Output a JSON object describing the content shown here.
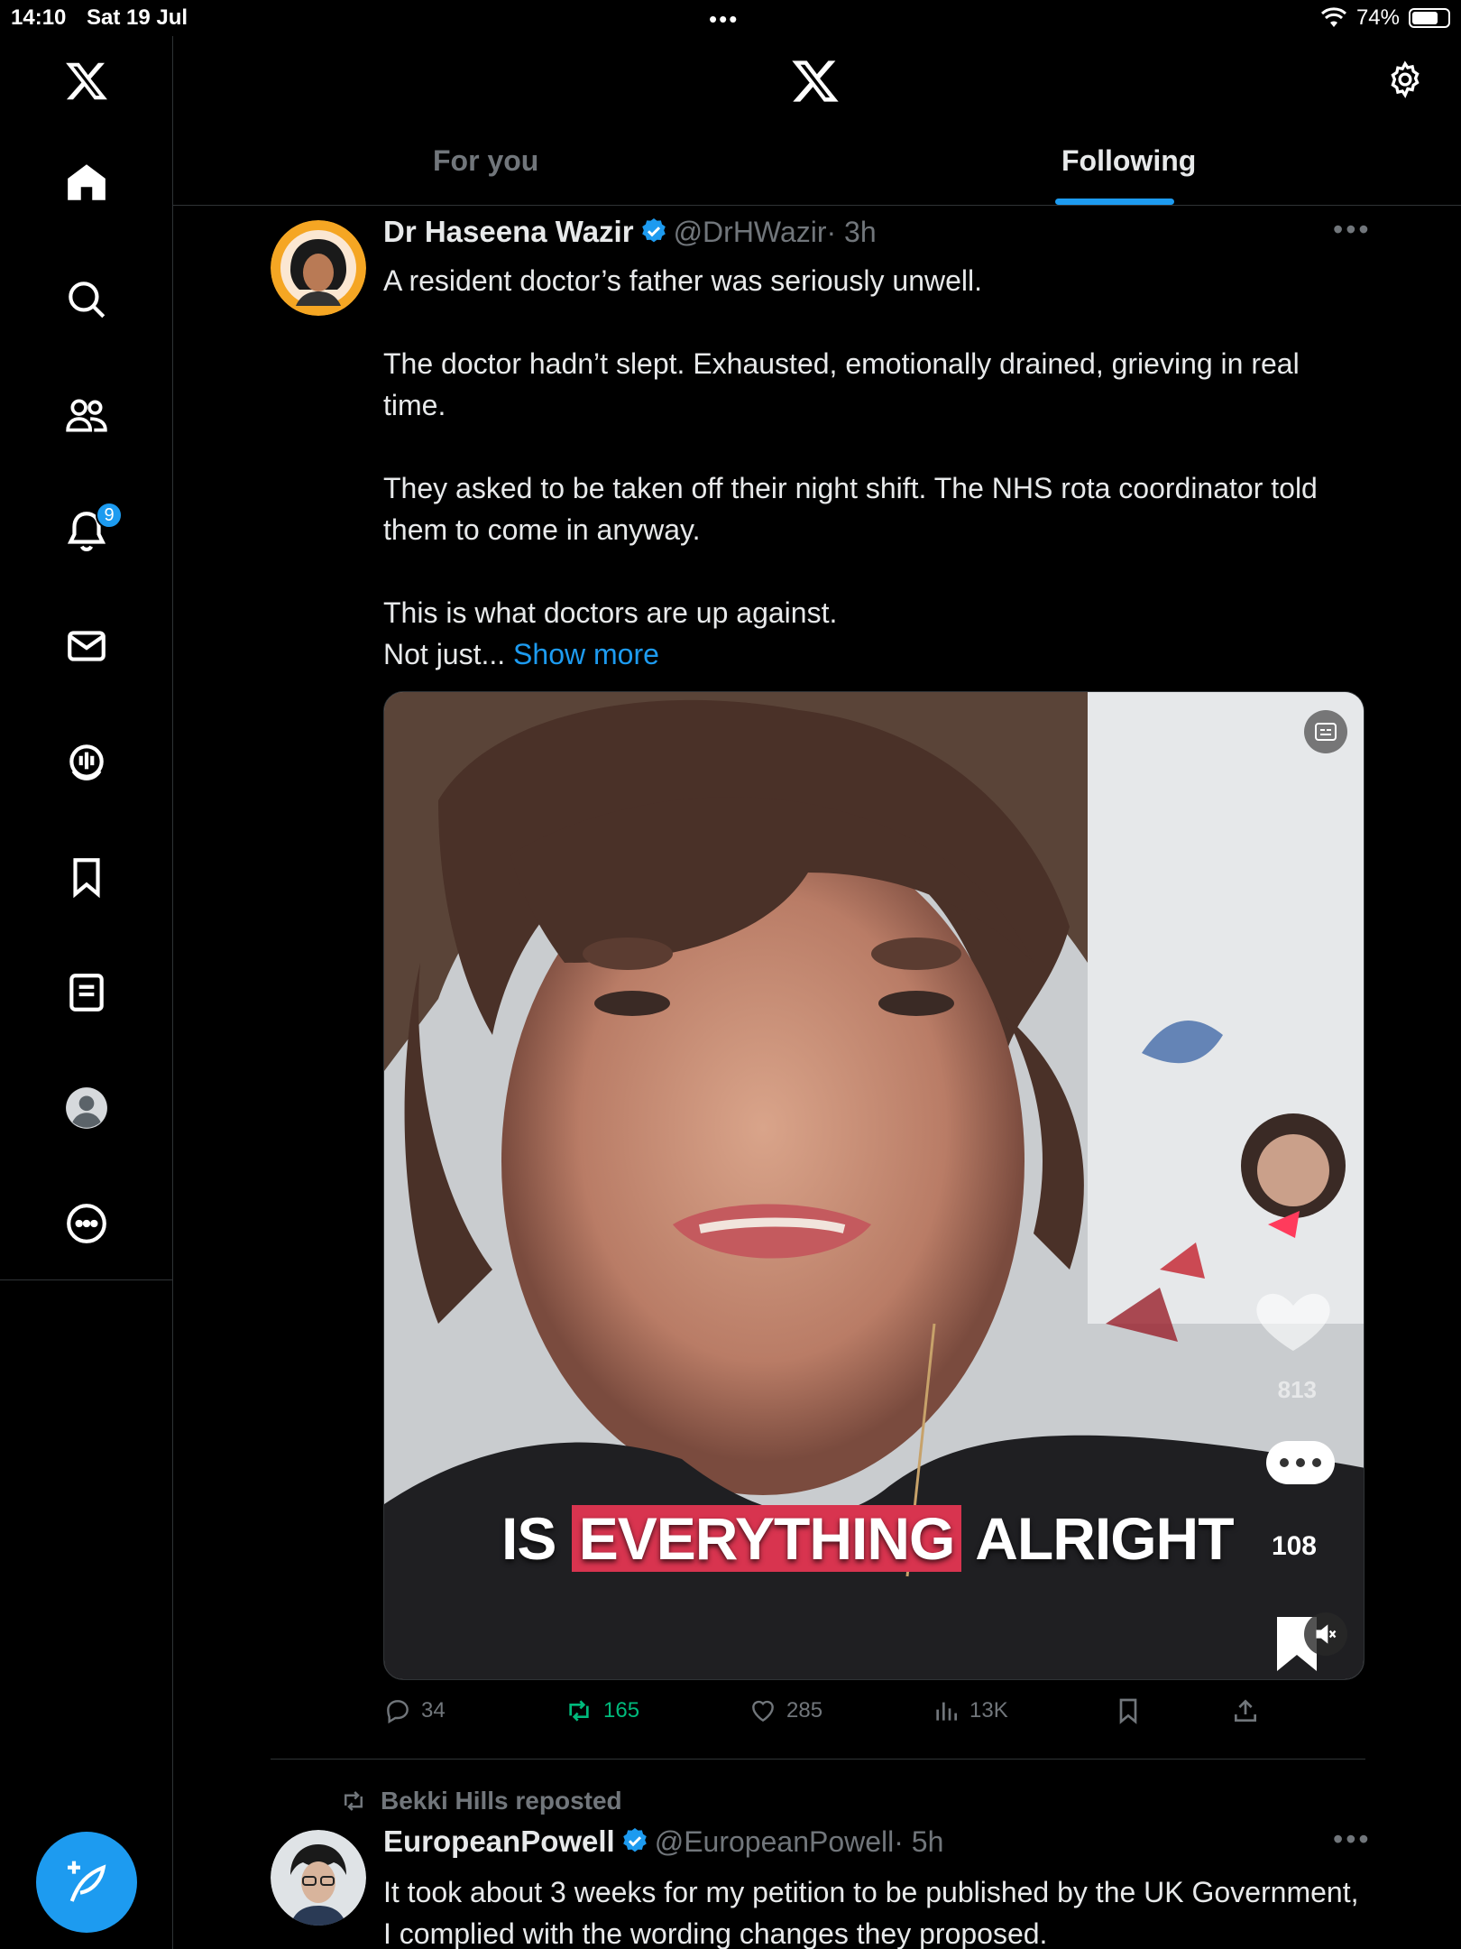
{
  "status_bar": {
    "time": "14:10",
    "date": "Sat 19 Jul",
    "dots": "•••",
    "battery": "74%",
    "battery_level": 0.74
  },
  "sidebar": {
    "items": [
      {
        "name": "x-logo-icon"
      },
      {
        "name": "home-icon"
      },
      {
        "name": "search-icon"
      },
      {
        "name": "communities-icon"
      },
      {
        "name": "notifications-icon",
        "badge": "9"
      },
      {
        "name": "messages-icon"
      },
      {
        "name": "spaces-icon"
      },
      {
        "name": "bookmarks-icon"
      },
      {
        "name": "lists-icon"
      },
      {
        "name": "profile-icon"
      },
      {
        "name": "more-icon"
      }
    ],
    "compose": "compose-icon"
  },
  "header": {
    "tabs": [
      {
        "label": "For you",
        "active": false
      },
      {
        "label": "Following",
        "active": true
      }
    ]
  },
  "posts": [
    {
      "author": "Dr Haseena Wazir",
      "handle": "@DrHWazir",
      "time": "· 3h",
      "text": "A resident doctor’s father was seriously unwell.\n\nThe doctor hadn’t slept. Exhausted, emotionally drained, grieving in real time.\n\nThey asked to be taken off their night shift. The NHS rota coordinator told them to come in anyway.\n\nThis is what doctors are up against.\nNot just...",
      "show_more": "Show more",
      "media": {
        "caption_pre": "IS ",
        "caption_highlight": "EVERYTHING",
        "caption_post": " ALRIGHT",
        "overlay_likes": "813",
        "overlay_comments": "108"
      },
      "stats": {
        "replies": "34",
        "reposts": "165",
        "likes": "285",
        "views": "13K"
      }
    },
    {
      "reposted_by": "Bekki Hills reposted",
      "author": "EuropeanPowell",
      "handle": "@EuropeanPowell",
      "time": "· 5h",
      "text": "It took about 3 weeks for my petition to be published by the UK Government, I complied with the wording changes they proposed."
    }
  ],
  "colors": {
    "accent": "#1d9bf0",
    "repost_green": "#00ba7c",
    "muted": "#71767b",
    "text": "#e7e9ea"
  }
}
